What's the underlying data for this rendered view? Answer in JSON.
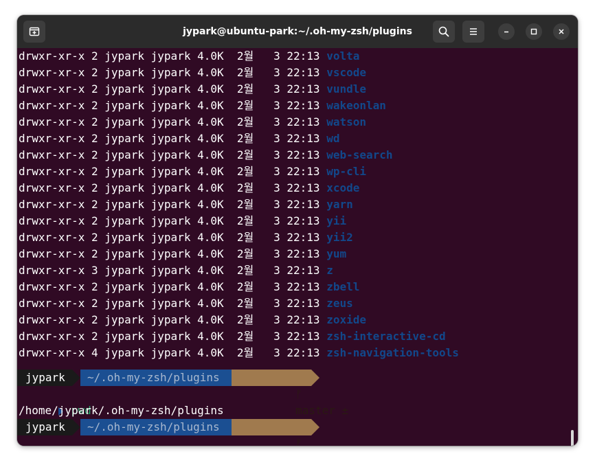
{
  "window": {
    "title": "jypark@ubuntu-park:~/.oh-my-zsh/plugins"
  },
  "titlebar": {
    "new_tab_icon": "new-tab-icon",
    "search_icon": "search-icon",
    "menu_icon": "hamburger-menu-icon",
    "minimize_icon": "minimize-icon",
    "maximize_icon": "maximize-icon",
    "close_icon": "close-icon"
  },
  "listing": [
    {
      "perms": "drwxr-xr-x 2 jypark jypark 4.0K  2월   3 22:13 ",
      "name": "volta"
    },
    {
      "perms": "drwxr-xr-x 2 jypark jypark 4.0K  2월   3 22:13 ",
      "name": "vscode"
    },
    {
      "perms": "drwxr-xr-x 2 jypark jypark 4.0K  2월   3 22:13 ",
      "name": "vundle"
    },
    {
      "perms": "drwxr-xr-x 2 jypark jypark 4.0K  2월   3 22:13 ",
      "name": "wakeonlan"
    },
    {
      "perms": "drwxr-xr-x 2 jypark jypark 4.0K  2월   3 22:13 ",
      "name": "watson"
    },
    {
      "perms": "drwxr-xr-x 2 jypark jypark 4.0K  2월   3 22:13 ",
      "name": "wd"
    },
    {
      "perms": "drwxr-xr-x 2 jypark jypark 4.0K  2월   3 22:13 ",
      "name": "web-search"
    },
    {
      "perms": "drwxr-xr-x 2 jypark jypark 4.0K  2월   3 22:13 ",
      "name": "wp-cli"
    },
    {
      "perms": "drwxr-xr-x 2 jypark jypark 4.0K  2월   3 22:13 ",
      "name": "xcode"
    },
    {
      "perms": "drwxr-xr-x 2 jypark jypark 4.0K  2월   3 22:13 ",
      "name": "yarn"
    },
    {
      "perms": "drwxr-xr-x 2 jypark jypark 4.0K  2월   3 22:13 ",
      "name": "yii"
    },
    {
      "perms": "drwxr-xr-x 2 jypark jypark 4.0K  2월   3 22:13 ",
      "name": "yii2"
    },
    {
      "perms": "drwxr-xr-x 2 jypark jypark 4.0K  2월   3 22:13 ",
      "name": "yum"
    },
    {
      "perms": "drwxr-xr-x 3 jypark jypark 4.0K  2월   3 22:13 ",
      "name": "z"
    },
    {
      "perms": "drwxr-xr-x 2 jypark jypark 4.0K  2월   3 22:13 ",
      "name": "zbell"
    },
    {
      "perms": "drwxr-xr-x 2 jypark jypark 4.0K  2월   3 22:13 ",
      "name": "zeus"
    },
    {
      "perms": "drwxr-xr-x 2 jypark jypark 4.0K  2월   3 22:13 ",
      "name": "zoxide"
    },
    {
      "perms": "drwxr-xr-x 2 jypark jypark 4.0K  2월   3 22:13 ",
      "name": "zsh-interactive-cd"
    },
    {
      "perms": "drwxr-xr-x 4 jypark jypark 4.0K  2월   3 22:13 ",
      "name": "zsh-navigation-tools"
    }
  ],
  "prompt": {
    "user": "jypark",
    "path": "~/.oh-my-zsh/plugins",
    "git_branch_icon": "git-branch-icon",
    "git_branch": "master ±"
  },
  "command": "pwd",
  "output": "/home/jypark/.oh-my-zsh/plugins",
  "colors": {
    "terminal_bg": "#300a24",
    "filename": "#12488b",
    "prompt_user_bg": "#1a1a1a",
    "prompt_path_bg": "#1b4f92",
    "prompt_git_bg": "#a07a4e",
    "command": "#26a269"
  }
}
